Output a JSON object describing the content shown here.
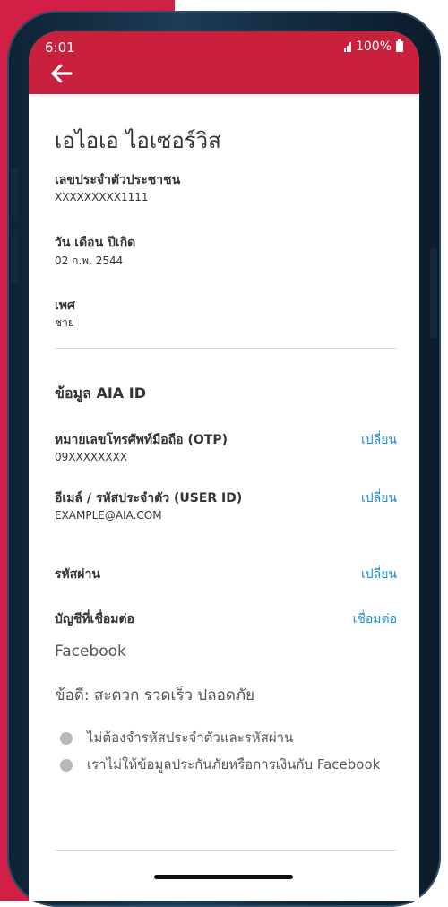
{
  "status_bar": {
    "time": "6:01",
    "battery": "100%"
  },
  "profile": {
    "name": "เอไอเอ ไอเซอร์วิส",
    "citizen_id_label": "เลขประจำตัวประชาชน",
    "citizen_id_value": "XXXXXXXXX1111",
    "dob_label": "วัน เดือน ปีเกิด",
    "dob_value": "02 ก.พ. 2544",
    "gender_label": "เพศ",
    "gender_value": "ชาย"
  },
  "aia_id": {
    "section_title": "ข้อมูล AIA ID",
    "phone_label": "หมายเลขโทรศัพท์มือถือ (OTP)",
    "phone_value": "09XXXXXXXX",
    "phone_action": "เปลี่ยน",
    "email_label": "อีเมล์ / รหัสประจำตัว (USER ID)",
    "email_value": "EXAMPLE@AIA.COM",
    "email_action": "เปลี่ยน",
    "password_label": "รหัสผ่าน",
    "password_action": "เปลี่ยน",
    "linked_label": "บัญชีที่เชื่อมต่อ",
    "linked_action": "เชื่อมต่อ",
    "linked_service": "Facebook",
    "benefits_title": "ข้อดี: สะดวก รวดเร็ว ปลอดภัย",
    "benefits": [
      "ไม่ต้องจำรหัสประจำตัวและรหัสผ่าน",
      "เราไม่ให้ข้อมูลประกันภัยหรือการเงินกับ Facebook"
    ]
  },
  "colors": {
    "brand_red": "#c8203d",
    "link_blue": "#1b8ed6"
  },
  "icons": {
    "back": "arrow-left-icon",
    "signal": "signal-icon",
    "battery": "battery-icon"
  }
}
